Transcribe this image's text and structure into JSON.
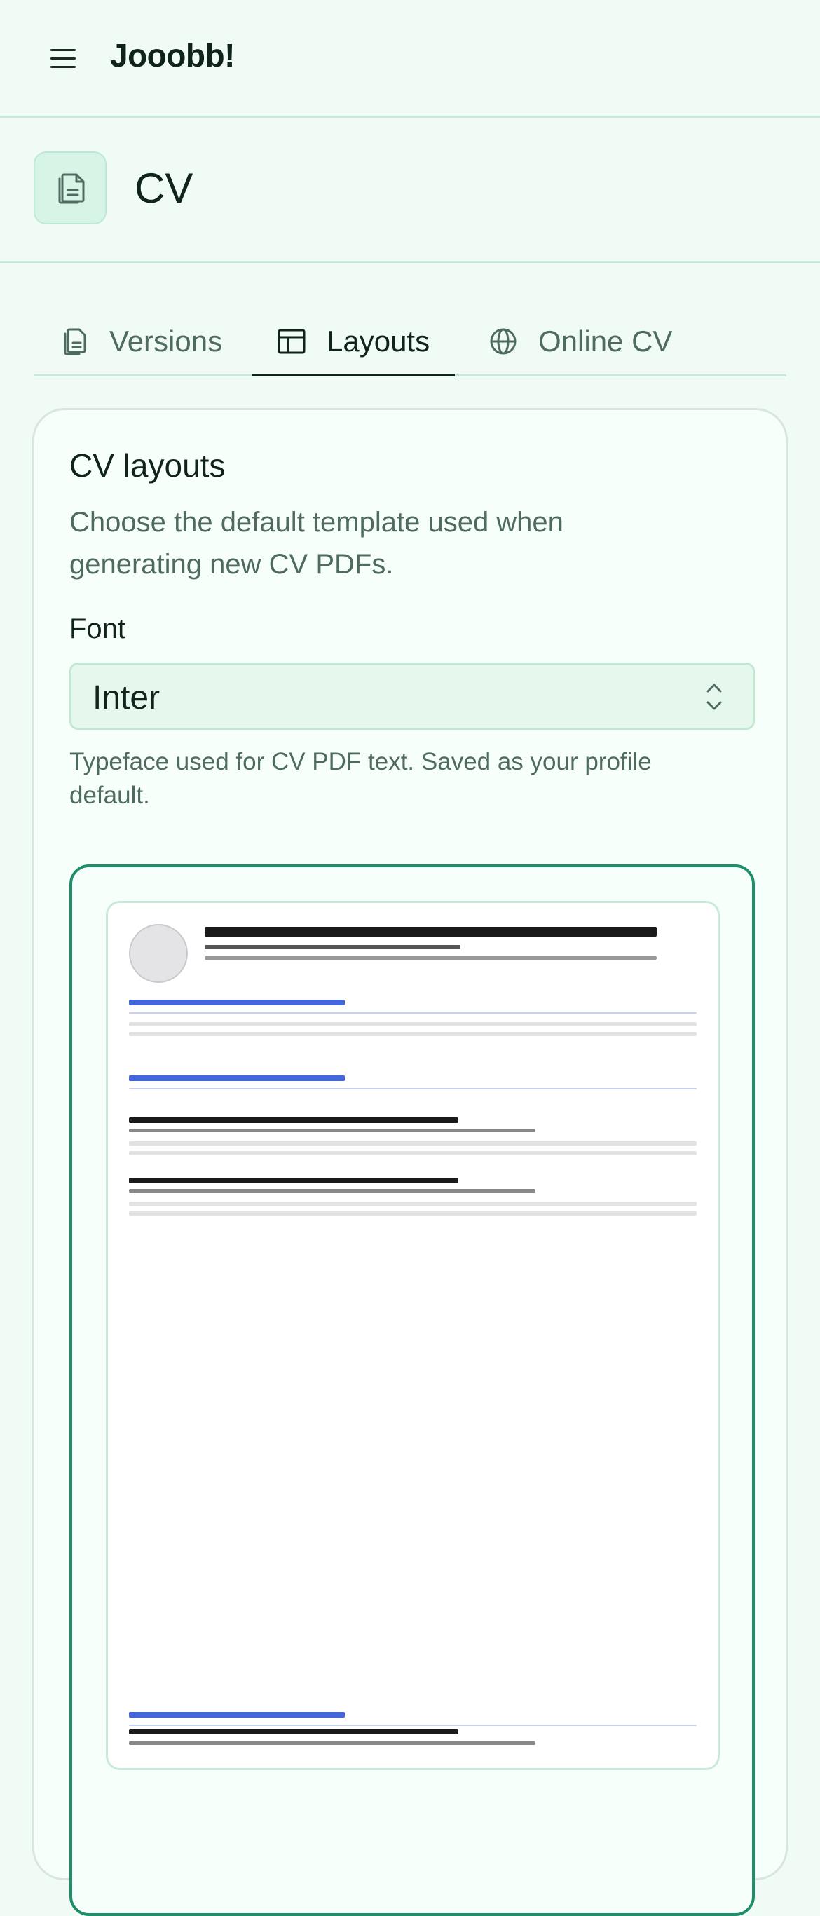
{
  "app": {
    "brand": "Jooobb!"
  },
  "header": {
    "title": "CV",
    "icon": "document-copy-icon"
  },
  "tabs": [
    {
      "label": "Versions",
      "icon": "documents-icon",
      "active": false
    },
    {
      "label": "Layouts",
      "icon": "layout-icon",
      "active": true
    },
    {
      "label": "Online CV",
      "icon": "globe-icon",
      "active": false
    }
  ],
  "card": {
    "title": "CV layouts",
    "description": "Choose the default template used when generating new CV PDFs.",
    "font_label": "Font",
    "font_value": "Inter",
    "font_hint": "Typeface used for CV PDF text. Saved as your profile default."
  },
  "colors": {
    "accent": "#1e8f6a",
    "section_rule": "#4466dd",
    "background": "#effbf4"
  }
}
